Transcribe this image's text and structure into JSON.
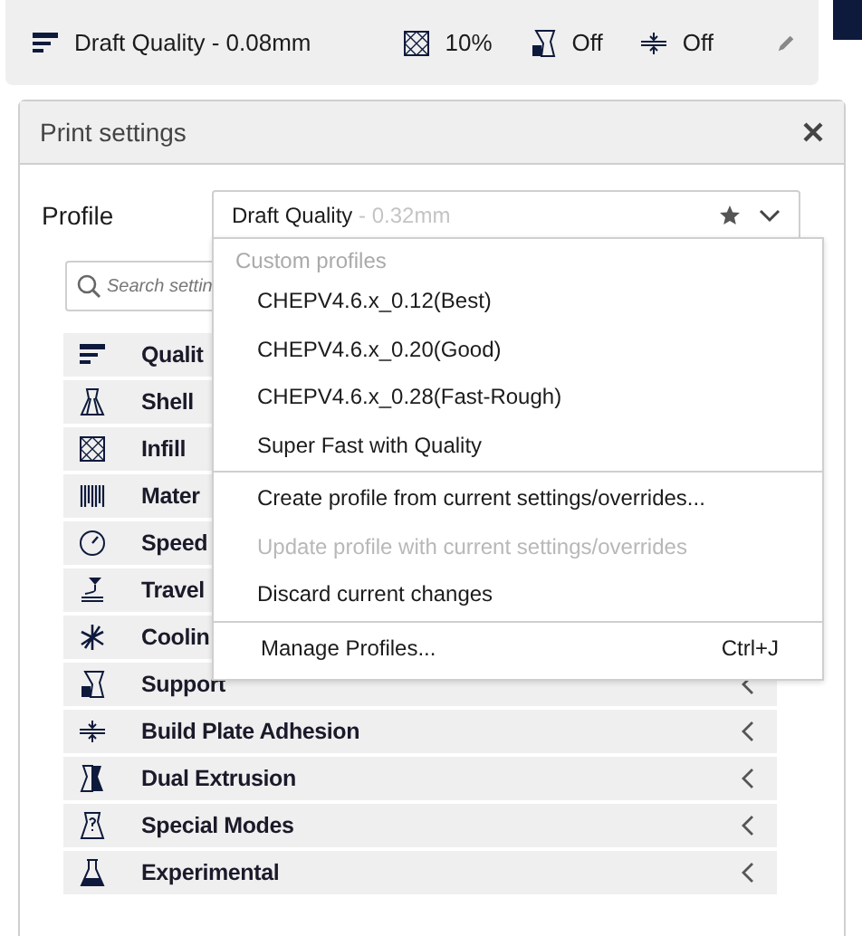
{
  "top_bar": {
    "items": [
      {
        "kind": "profile",
        "text": "Draft Quality - 0.08mm"
      },
      {
        "kind": "infill",
        "text": "10%"
      },
      {
        "kind": "support",
        "text": "Off"
      },
      {
        "kind": "adhesion",
        "text": "Off"
      }
    ]
  },
  "panel": {
    "title": "Print settings",
    "profile_label": "Profile",
    "profile_name": "Draft Quality",
    "profile_detail": " - 0.32mm",
    "search": {
      "placeholder": "Search settin"
    },
    "categories": [
      {
        "kind": "quality",
        "label": "Qualit",
        "chevron": false
      },
      {
        "kind": "shell",
        "label": "Shell",
        "chevron": false
      },
      {
        "kind": "infill",
        "label": "Infill",
        "chevron": false
      },
      {
        "kind": "material",
        "label": "Mater",
        "chevron": false
      },
      {
        "kind": "speed",
        "label": "Speed",
        "chevron": false
      },
      {
        "kind": "travel",
        "label": "Travel",
        "chevron": false
      },
      {
        "kind": "cooling",
        "label": "Coolin",
        "chevron": false
      },
      {
        "kind": "support",
        "label": "Support",
        "chevron": true
      },
      {
        "kind": "adhesion",
        "label": "Build Plate Adhesion",
        "chevron": true
      },
      {
        "kind": "dual",
        "label": "Dual Extrusion",
        "chevron": true
      },
      {
        "kind": "special",
        "label": "Special Modes",
        "chevron": true
      },
      {
        "kind": "experimental",
        "label": "Experimental",
        "chevron": true
      }
    ]
  },
  "profile_menu": {
    "items": [
      {
        "kind": "header",
        "text": "Custom profiles"
      },
      {
        "kind": "item",
        "text": "CHEPV4.6.x_0.12(Best)",
        "disabled": false
      },
      {
        "kind": "item",
        "text": "CHEPV4.6.x_0.20(Good)",
        "disabled": false
      },
      {
        "kind": "item",
        "text": "CHEPV4.6.x_0.28(Fast-Rough)",
        "disabled": false
      },
      {
        "kind": "item",
        "text": "Super Fast with Quality",
        "disabled": false
      },
      {
        "kind": "separator"
      },
      {
        "kind": "item",
        "text": "Create profile from current settings/overrides...",
        "disabled": false
      },
      {
        "kind": "item",
        "text": "Update profile with current settings/overrides",
        "disabled": true
      },
      {
        "kind": "item",
        "text": "Discard current changes",
        "disabled": false
      },
      {
        "kind": "separator"
      },
      {
        "kind": "shortcut",
        "text": "Manage Profiles...",
        "shortcut": "Ctrl+J",
        "disabled": false
      }
    ]
  }
}
